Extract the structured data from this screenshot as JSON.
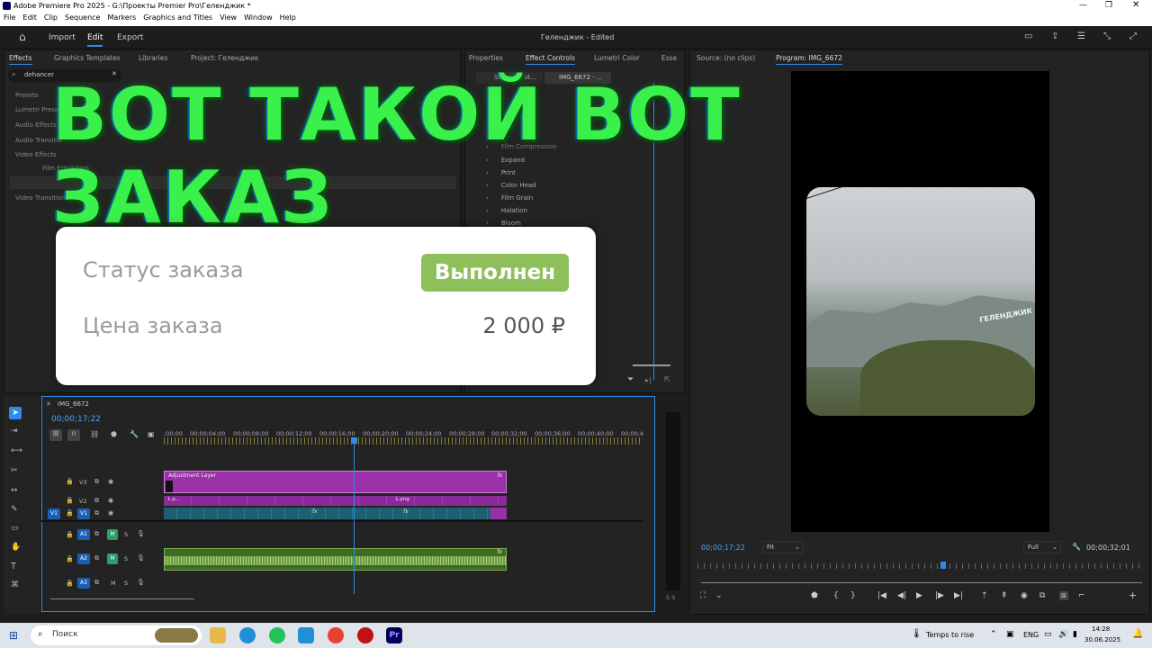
{
  "window": {
    "title": "Adobe Premiere Pro 2025 - G:\\Проекты Premier Pro\\Геленджик *"
  },
  "menu": [
    "File",
    "Edit",
    "Clip",
    "Sequence",
    "Markers",
    "Graphics and Titles",
    "View",
    "Window",
    "Help"
  ],
  "header": {
    "import": "Import",
    "edit": "Edit",
    "export": "Export",
    "project_title": "Геленджик - Edited"
  },
  "left_panel": {
    "tabs": [
      "Effects",
      "Graphics Templates",
      "Libraries",
      "Project: Геленджик"
    ],
    "search_value": "dehancer",
    "tree": [
      "Presets",
      "Lumetri Presets",
      "Audio Effects",
      "Audio Transitions",
      "Video Effects",
      "Film Emulation",
      "Video Transitions"
    ]
  },
  "effect_controls": {
    "tabs": [
      "Properties",
      "Effect Controls",
      "Lumetri Color",
      "Esse"
    ],
    "source_tab": "Source · Ad...",
    "clip_tab": "IMG_6672 · ...",
    "items": [
      "Film Compression",
      "Expand",
      "Print",
      "Color Head",
      "Film Grain",
      "Halation",
      "Bloom"
    ]
  },
  "program_monitor": {
    "source_tab": "Source: (no clips)",
    "program_tab": "Program: IMG_6672",
    "timecode": "00;00;17;22",
    "fit": "Fit",
    "quality": "Full",
    "duration": "00;00;32;01",
    "sign_text": "ГЕЛЕНДЖИК"
  },
  "overlay": {
    "line1": "ВОТ ТАКОЙ ВОТ",
    "line2": "ЗАКАЗ",
    "status_label": "Статус заказа",
    "status_value": "Выполнен",
    "price_label": "Цена заказа",
    "price_value": "2 000 ₽",
    "status_color": "#8fbf5a"
  },
  "timeline": {
    "sequence_name": "IMG_6672",
    "timecode": "00;00;17;22",
    "ruler": [
      ";00;00",
      "00;00;04;00",
      "00;00;08;00",
      "00;00;12;00",
      "00;00;16;00",
      "00;00;20;00",
      "00;00;24;00",
      "00;00;28;00",
      "00;00;32;00",
      "00;00;36;00",
      "00;00;40;00",
      "00;00;4"
    ],
    "tracks": {
      "v3": "V3",
      "v2": "V2",
      "v1": "V1",
      "a1": "A1",
      "a2": "A2",
      "a3": "A3",
      "m": "M",
      "s": "S"
    },
    "adjustment_layer": "Adjustment Layer",
    "clip_v2a": "1.p...",
    "clip_v2b": "1.png",
    "fx": "fx",
    "meter_s": "S S"
  },
  "taskbar": {
    "search_placeholder": "Поиск",
    "weather": "Temps to rise",
    "lang": "ENG",
    "time": "14:28",
    "date": "30.06.2025"
  },
  "colors": {
    "accent": "#2d8ceb",
    "adjustment": "#9b30a8",
    "v1_clip": "#1f5f72",
    "audio": "#4d7a2f",
    "green_text": "#3af04a"
  }
}
